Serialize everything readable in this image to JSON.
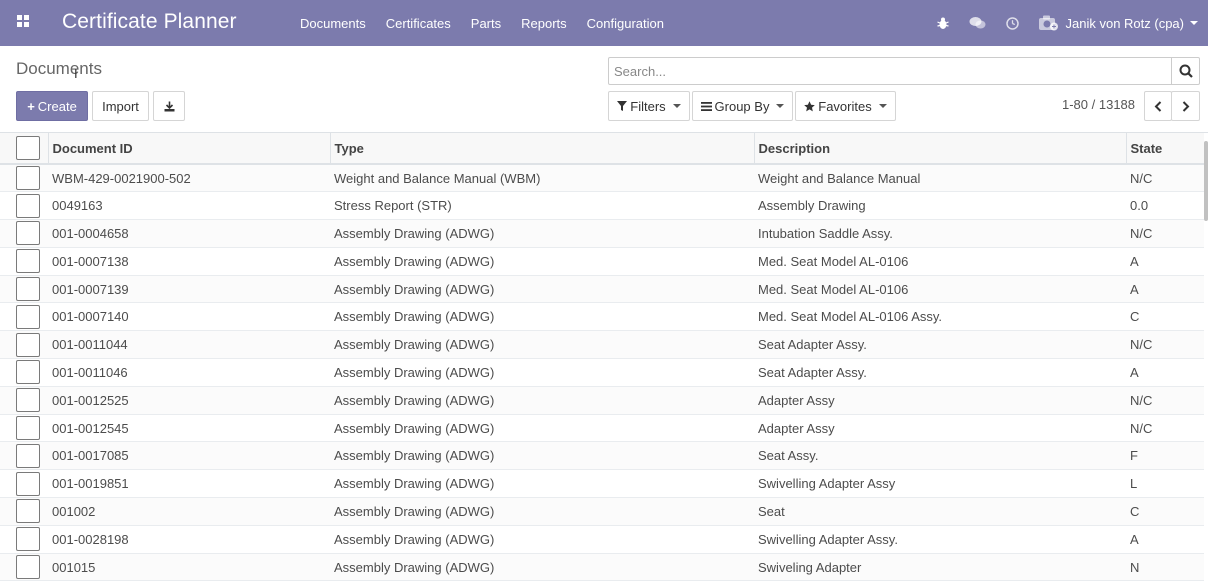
{
  "navbar": {
    "brand": "Certificate Planner",
    "menu": [
      "Documents",
      "Certificates",
      "Parts",
      "Reports",
      "Configuration"
    ],
    "user": "Janik von Rotz (cpa)"
  },
  "control_panel": {
    "title": "Documents",
    "create_label": "Create",
    "import_label": "Import",
    "search_placeholder": "Search...",
    "filters_label": "Filters",
    "groupby_label": "Group By",
    "favorites_label": "Favorites",
    "pager": "1-80 / 13188"
  },
  "table": {
    "columns": [
      "Document ID",
      "Type",
      "Description",
      "State"
    ],
    "rows": [
      [
        "WBM-429-0021900-502",
        "Weight and Balance Manual (WBM)",
        "Weight and Balance Manual",
        "N/C"
      ],
      [
        "0049163",
        "Stress Report (STR)",
        "Assembly Drawing",
        "0.0"
      ],
      [
        "001-0004658",
        "Assembly Drawing (ADWG)",
        "Intubation Saddle Assy.",
        "N/C"
      ],
      [
        "001-0007138",
        "Assembly Drawing (ADWG)",
        "Med. Seat Model AL-0106",
        "A"
      ],
      [
        "001-0007139",
        "Assembly Drawing (ADWG)",
        "Med. Seat Model AL-0106",
        "A"
      ],
      [
        "001-0007140",
        "Assembly Drawing (ADWG)",
        "Med. Seat Model AL-0106 Assy.",
        "C"
      ],
      [
        "001-0011044",
        "Assembly Drawing (ADWG)",
        "Seat Adapter Assy.",
        "N/C"
      ],
      [
        "001-0011046",
        "Assembly Drawing (ADWG)",
        "Seat Adapter Assy.",
        "A"
      ],
      [
        "001-0012525",
        "Assembly Drawing (ADWG)",
        "Adapter Assy",
        "N/C"
      ],
      [
        "001-0012545",
        "Assembly Drawing (ADWG)",
        "Adapter Assy",
        "N/C"
      ],
      [
        "001-0017085",
        "Assembly Drawing (ADWG)",
        "Seat Assy.",
        "F"
      ],
      [
        "001-0019851",
        "Assembly Drawing (ADWG)",
        "Swivelling Adapter Assy",
        "L"
      ],
      [
        "001002",
        "Assembly Drawing (ADWG)",
        "Seat",
        "C"
      ],
      [
        "001-0028198",
        "Assembly Drawing (ADWG)",
        "Swivelling Adapter Assy.",
        "A"
      ],
      [
        "001015",
        "Assembly Drawing (ADWG)",
        "Swiveling Adapter",
        "N"
      ]
    ]
  }
}
